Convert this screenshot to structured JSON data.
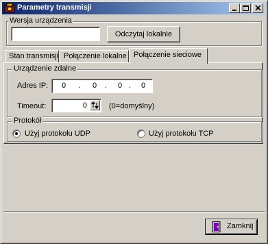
{
  "window": {
    "title": "Parametry transmisji"
  },
  "titlebar_buttons": [
    "minimize-icon",
    "maximize-icon",
    "close-icon"
  ],
  "device_version": {
    "label": "Wersja urządzenia",
    "value": "",
    "read_button": "Odczytaj lokalnie"
  },
  "tabs": [
    {
      "label": "Stan transmisji",
      "active": false
    },
    {
      "label": "Połączenie lokalne",
      "active": false
    },
    {
      "label": "Połączenie sieciowe",
      "active": true
    }
  ],
  "remote_device": {
    "label": "Urządzenie zdalne",
    "ip_label": "Adres IP:",
    "ip_octets": [
      "0",
      "0",
      "0",
      "0"
    ],
    "ip_separator": ".",
    "timeout_label": "Timeout:",
    "timeout_value": "0",
    "timeout_hint": "(0=domyślny)"
  },
  "protocol": {
    "label": "Protokół",
    "options": [
      {
        "label": "Użyj protokołu UDP",
        "selected": true
      },
      {
        "label": "Użyj protokołu TCP",
        "selected": false
      }
    ]
  },
  "footer": {
    "close_button": "Zamknij"
  },
  "colors": {
    "title_start": "#0a246a",
    "title_end": "#a6caf0",
    "face": "#d4d0c8"
  }
}
